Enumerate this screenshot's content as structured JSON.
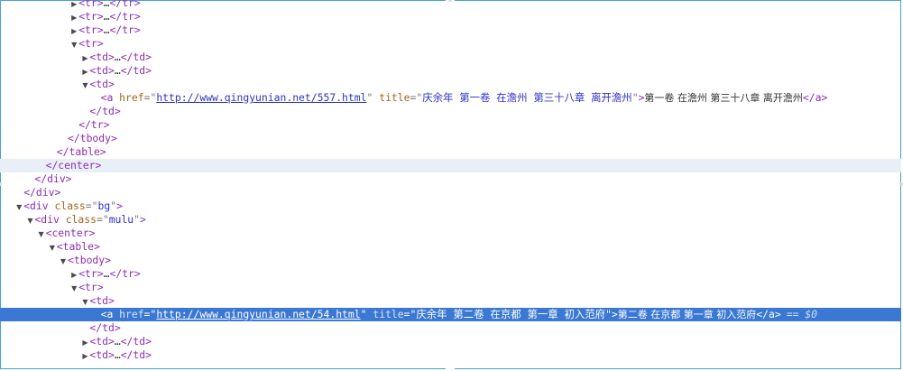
{
  "rows": [
    {
      "indent": 6,
      "twisty": "collapsed",
      "parts": [
        [
          "tag",
          "<tr>"
        ],
        [
          "ell",
          "…"
        ],
        [
          "tag",
          "</tr>"
        ]
      ]
    },
    {
      "indent": 6,
      "twisty": "collapsed",
      "parts": [
        [
          "tag",
          "<tr>"
        ],
        [
          "ell",
          "…"
        ],
        [
          "tag",
          "</tr>"
        ]
      ]
    },
    {
      "indent": 6,
      "twisty": "collapsed",
      "parts": [
        [
          "tag",
          "<tr>"
        ],
        [
          "ell",
          "…"
        ],
        [
          "tag",
          "</tr>"
        ]
      ]
    },
    {
      "indent": 6,
      "twisty": "expanded",
      "parts": [
        [
          "tag",
          "<tr>"
        ]
      ]
    },
    {
      "indent": 7,
      "twisty": "collapsed",
      "parts": [
        [
          "tag",
          "<td>"
        ],
        [
          "ell",
          "…"
        ],
        [
          "tag",
          "</td>"
        ]
      ]
    },
    {
      "indent": 7,
      "twisty": "collapsed",
      "parts": [
        [
          "tag",
          "<td>"
        ],
        [
          "ell",
          "…"
        ],
        [
          "tag",
          "</td>"
        ]
      ]
    },
    {
      "indent": 7,
      "twisty": "expanded",
      "parts": [
        [
          "tag",
          "<td>"
        ]
      ]
    },
    {
      "indent": 8,
      "twisty": "none",
      "parts": [
        [
          "tag",
          "<a "
        ],
        [
          "an",
          "href"
        ],
        [
          "eq",
          "=\""
        ],
        [
          "link",
          "http://www.qingyunian.net/557.html"
        ],
        [
          "eq",
          "\" "
        ],
        [
          "an",
          "title"
        ],
        [
          "eq",
          "=\""
        ],
        [
          "av",
          "庆余年 第一卷 在澹州 第三十八章 离开澹州"
        ],
        [
          "eq",
          "\""
        ],
        [
          "tag",
          ">"
        ],
        [
          "txt",
          "第一卷 在澹州 第三十八章 离开澹州"
        ],
        [
          "tag",
          "</a>"
        ]
      ]
    },
    {
      "indent": 7,
      "twisty": "none",
      "parts": [
        [
          "tag",
          "</td>"
        ]
      ]
    },
    {
      "indent": 6,
      "twisty": "none",
      "parts": [
        [
          "tag",
          "</tr>"
        ]
      ]
    },
    {
      "indent": 5,
      "twisty": "none",
      "parts": [
        [
          "tag",
          "</tbody>"
        ]
      ]
    },
    {
      "indent": 4,
      "twisty": "none",
      "parts": [
        [
          "tag",
          "</table>"
        ]
      ]
    },
    {
      "indent": 3,
      "twisty": "none",
      "hover": true,
      "parts": [
        [
          "tag",
          "</center>"
        ]
      ]
    },
    {
      "indent": 2,
      "twisty": "none",
      "parts": [
        [
          "tag",
          "</div>"
        ]
      ]
    },
    {
      "indent": 1,
      "twisty": "none",
      "parts": [
        [
          "tag",
          "</div>"
        ]
      ]
    },
    {
      "indent": 1,
      "twisty": "expanded",
      "parts": [
        [
          "tag",
          "<div "
        ],
        [
          "an",
          "class"
        ],
        [
          "eq",
          "=\""
        ],
        [
          "av",
          "bg"
        ],
        [
          "eq",
          "\""
        ],
        [
          "tag",
          ">"
        ]
      ]
    },
    {
      "indent": 2,
      "twisty": "expanded",
      "parts": [
        [
          "tag",
          "<div "
        ],
        [
          "an",
          "class"
        ],
        [
          "eq",
          "=\""
        ],
        [
          "av",
          "mulu"
        ],
        [
          "eq",
          "\""
        ],
        [
          "tag",
          ">"
        ]
      ]
    },
    {
      "indent": 3,
      "twisty": "expanded",
      "parts": [
        [
          "tag",
          "<center>"
        ]
      ]
    },
    {
      "indent": 4,
      "twisty": "expanded",
      "parts": [
        [
          "tag",
          "<table>"
        ]
      ]
    },
    {
      "indent": 5,
      "twisty": "expanded",
      "parts": [
        [
          "tag",
          "<tbody>"
        ]
      ]
    },
    {
      "indent": 6,
      "twisty": "collapsed",
      "parts": [
        [
          "tag",
          "<tr>"
        ],
        [
          "ell",
          "…"
        ],
        [
          "tag",
          "</tr>"
        ]
      ]
    },
    {
      "indent": 6,
      "twisty": "expanded",
      "parts": [
        [
          "tag",
          "<tr>"
        ]
      ]
    },
    {
      "indent": 7,
      "twisty": "expanded",
      "parts": [
        [
          "tag",
          "<td>"
        ]
      ]
    },
    {
      "indent": 8,
      "twisty": "none",
      "selected": true,
      "parts": [
        [
          "tag",
          "<a "
        ],
        [
          "an",
          "href"
        ],
        [
          "eq",
          "=\""
        ],
        [
          "link",
          "http://www.qingyunian.net/54.html"
        ],
        [
          "eq",
          "\" "
        ],
        [
          "an",
          "title"
        ],
        [
          "eq",
          "=\""
        ],
        [
          "av",
          "庆余年 第二卷 在京都 第一章 初入范府"
        ],
        [
          "eq",
          "\""
        ],
        [
          "tag",
          ">"
        ],
        [
          "txt",
          "第二卷 在京都 第一章 初入范府"
        ],
        [
          "tag",
          "</a>"
        ]
      ],
      "marker": "== $0"
    },
    {
      "indent": 7,
      "twisty": "none",
      "parts": [
        [
          "tag",
          "</td>"
        ]
      ]
    },
    {
      "indent": 7,
      "twisty": "collapsed",
      "parts": [
        [
          "tag",
          "<td>"
        ],
        [
          "ell",
          "…"
        ],
        [
          "tag",
          "</td>"
        ]
      ]
    },
    {
      "indent": 7,
      "twisty": "collapsed",
      "parts": [
        [
          "tag",
          "<td>"
        ],
        [
          "ell",
          "…"
        ],
        [
          "tag",
          "</td>"
        ]
      ]
    }
  ]
}
